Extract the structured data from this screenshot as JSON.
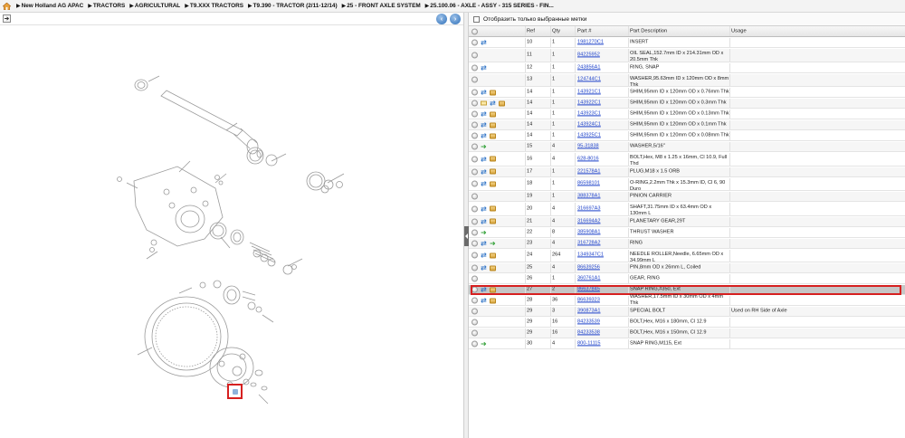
{
  "breadcrumb": [
    "New Holland AG APAC",
    "TRACTORS",
    "AGRICULTURAL",
    "T9.XXX TRACTORS",
    "T9.390 - TRACTOR (2/11-12/14)",
    "25 - FRONT AXLE SYSTEM",
    "25.100.06 - AXLE - ASSY - 315 SERIES - FIN..."
  ],
  "filter_label": "Отобразить только выбранные метки",
  "headers": {
    "ref": "Ref",
    "qty": "Qty",
    "part": "Part #",
    "desc": "Part Description",
    "usage": "Usage"
  },
  "rows": [
    {
      "icons": [
        "circle",
        "swap"
      ],
      "ref": "10",
      "qty": "1",
      "part": "1981270C1",
      "desc": "INSERT",
      "usage": ""
    },
    {
      "icons": [
        "circle"
      ],
      "ref": "11",
      "qty": "1",
      "part": "84225952",
      "desc": "OIL SEAL,152.7mm ID x 214.31mm OD x 20.5mm Thk",
      "usage": ""
    },
    {
      "icons": [
        "circle",
        "swap"
      ],
      "ref": "12",
      "qty": "1",
      "part": "243856A1",
      "desc": "RING, SNAP",
      "usage": ""
    },
    {
      "icons": [
        "circle"
      ],
      "ref": "13",
      "qty": "1",
      "part": "124744C1",
      "desc": "WASHER,95.63mm ID x 120mm OD x 8mm Thk",
      "usage": ""
    },
    {
      "icons": [
        "circle",
        "swap",
        "box"
      ],
      "ref": "14",
      "qty": "1",
      "part": "143921C1",
      "desc": "SHIM,95mm ID x 120mm OD x 0.76mm Thk",
      "usage": ""
    },
    {
      "icons": [
        "circle",
        "mail",
        "swap",
        "box"
      ],
      "ref": "14",
      "qty": "1",
      "part": "143922C1",
      "desc": "SHIM,95mm ID x 120mm OD x 0.3mm Thk",
      "usage": ""
    },
    {
      "icons": [
        "circle",
        "swap",
        "box"
      ],
      "ref": "14",
      "qty": "1",
      "part": "143923C1",
      "desc": "SHIM,95mm ID x 120mm OD x 0.13mm Thk",
      "usage": ""
    },
    {
      "icons": [
        "circle",
        "swap",
        "box"
      ],
      "ref": "14",
      "qty": "1",
      "part": "143924C1",
      "desc": "SHIM,95mm ID x 120mm OD x 0.1mm Thk",
      "usage": ""
    },
    {
      "icons": [
        "circle",
        "swap",
        "box"
      ],
      "ref": "14",
      "qty": "1",
      "part": "143925C1",
      "desc": "SHIM,95mm ID x 120mm OD x 0.08mm Thk",
      "usage": ""
    },
    {
      "icons": [
        "circle",
        "green"
      ],
      "ref": "15",
      "qty": "4",
      "part": "95-31838",
      "desc": "WASHER,5/16\"",
      "usage": ""
    },
    {
      "icons": [
        "circle",
        "swap",
        "box"
      ],
      "ref": "16",
      "qty": "4",
      "part": "628-8016",
      "desc": "BOLT,Hex, M8 x 1.25 x 16mm, Cl 10.9, Full Thd",
      "usage": ""
    },
    {
      "icons": [
        "circle",
        "swap",
        "box"
      ],
      "ref": "17",
      "qty": "1",
      "part": "221578A1",
      "desc": "PLUG,M18 x 1.5 ORB",
      "usage": ""
    },
    {
      "icons": [
        "circle",
        "swap",
        "box"
      ],
      "ref": "18",
      "qty": "1",
      "part": "86598101",
      "desc": "O-RING,2.2mm Thk x 15.3mm ID, Cl 6, 90 Duro",
      "usage": ""
    },
    {
      "icons": [
        "circle"
      ],
      "ref": "19",
      "qty": "1",
      "part": "388378A1",
      "desc": "PINION CARRIER",
      "usage": ""
    },
    {
      "icons": [
        "circle",
        "swap",
        "box"
      ],
      "ref": "20",
      "qty": "4",
      "part": "316697A3",
      "desc": "SHAFT,31.75mm ID x 63.4mm OD x 130mm L",
      "usage": ""
    },
    {
      "icons": [
        "circle",
        "swap",
        "box"
      ],
      "ref": "21",
      "qty": "4",
      "part": "316694A2",
      "desc": "PLANETARY GEAR,29T",
      "usage": ""
    },
    {
      "icons": [
        "circle",
        "green"
      ],
      "ref": "22",
      "qty": "8",
      "part": "385908A1",
      "desc": "THRUST WASHER",
      "usage": ""
    },
    {
      "icons": [
        "circle",
        "swap",
        "green"
      ],
      "ref": "23",
      "qty": "4",
      "part": "316728A2",
      "desc": "RING",
      "usage": ""
    },
    {
      "icons": [
        "circle",
        "swap",
        "box"
      ],
      "ref": "24",
      "qty": "264",
      "part": "1349347C1",
      "desc": "NEEDLE ROLLER,Needle, 6.65mm OD x 34.99mm L",
      "usage": ""
    },
    {
      "icons": [
        "circle",
        "swap",
        "box"
      ],
      "ref": "25",
      "qty": "4",
      "part": "86639256",
      "desc": "PIN,8mm OD x 26mm L, Coiled",
      "usage": ""
    },
    {
      "icons": [
        "circle"
      ],
      "ref": "26",
      "qty": "1",
      "part": "360761A1",
      "desc": "GEAR, RING",
      "usage": ""
    },
    {
      "icons": [
        "circle",
        "swap",
        "box"
      ],
      "ref": "27",
      "qty": "2",
      "part": "86637845",
      "desc": "SNAP RING,#350, Ext",
      "usage": "",
      "selected": true
    },
    {
      "icons": [
        "circle",
        "swap",
        "box"
      ],
      "ref": "28",
      "qty": "36",
      "part": "86639323",
      "desc": "WASHER,17.5mm ID x 30mm OD x 4mm Thk",
      "usage": ""
    },
    {
      "icons": [
        "circle"
      ],
      "ref": "29",
      "qty": "3",
      "part": "390873A1",
      "desc": "SPECIAL BOLT",
      "usage": "Used on RH Side of Axle"
    },
    {
      "icons": [
        "circle"
      ],
      "ref": "29",
      "qty": "16",
      "part": "84233539",
      "desc": "BOLT,Hex, M16 x 180mm, Cl 12.9",
      "usage": ""
    },
    {
      "icons": [
        "circle"
      ],
      "ref": "29",
      "qty": "16",
      "part": "84233538",
      "desc": "BOLT,Hex, M16 x 150mm, Cl 12.9",
      "usage": ""
    },
    {
      "icons": [
        "circle",
        "green"
      ],
      "ref": "30",
      "qty": "4",
      "part": "800-11115",
      "desc": "SNAP RING,M115, Ext",
      "usage": ""
    }
  ]
}
